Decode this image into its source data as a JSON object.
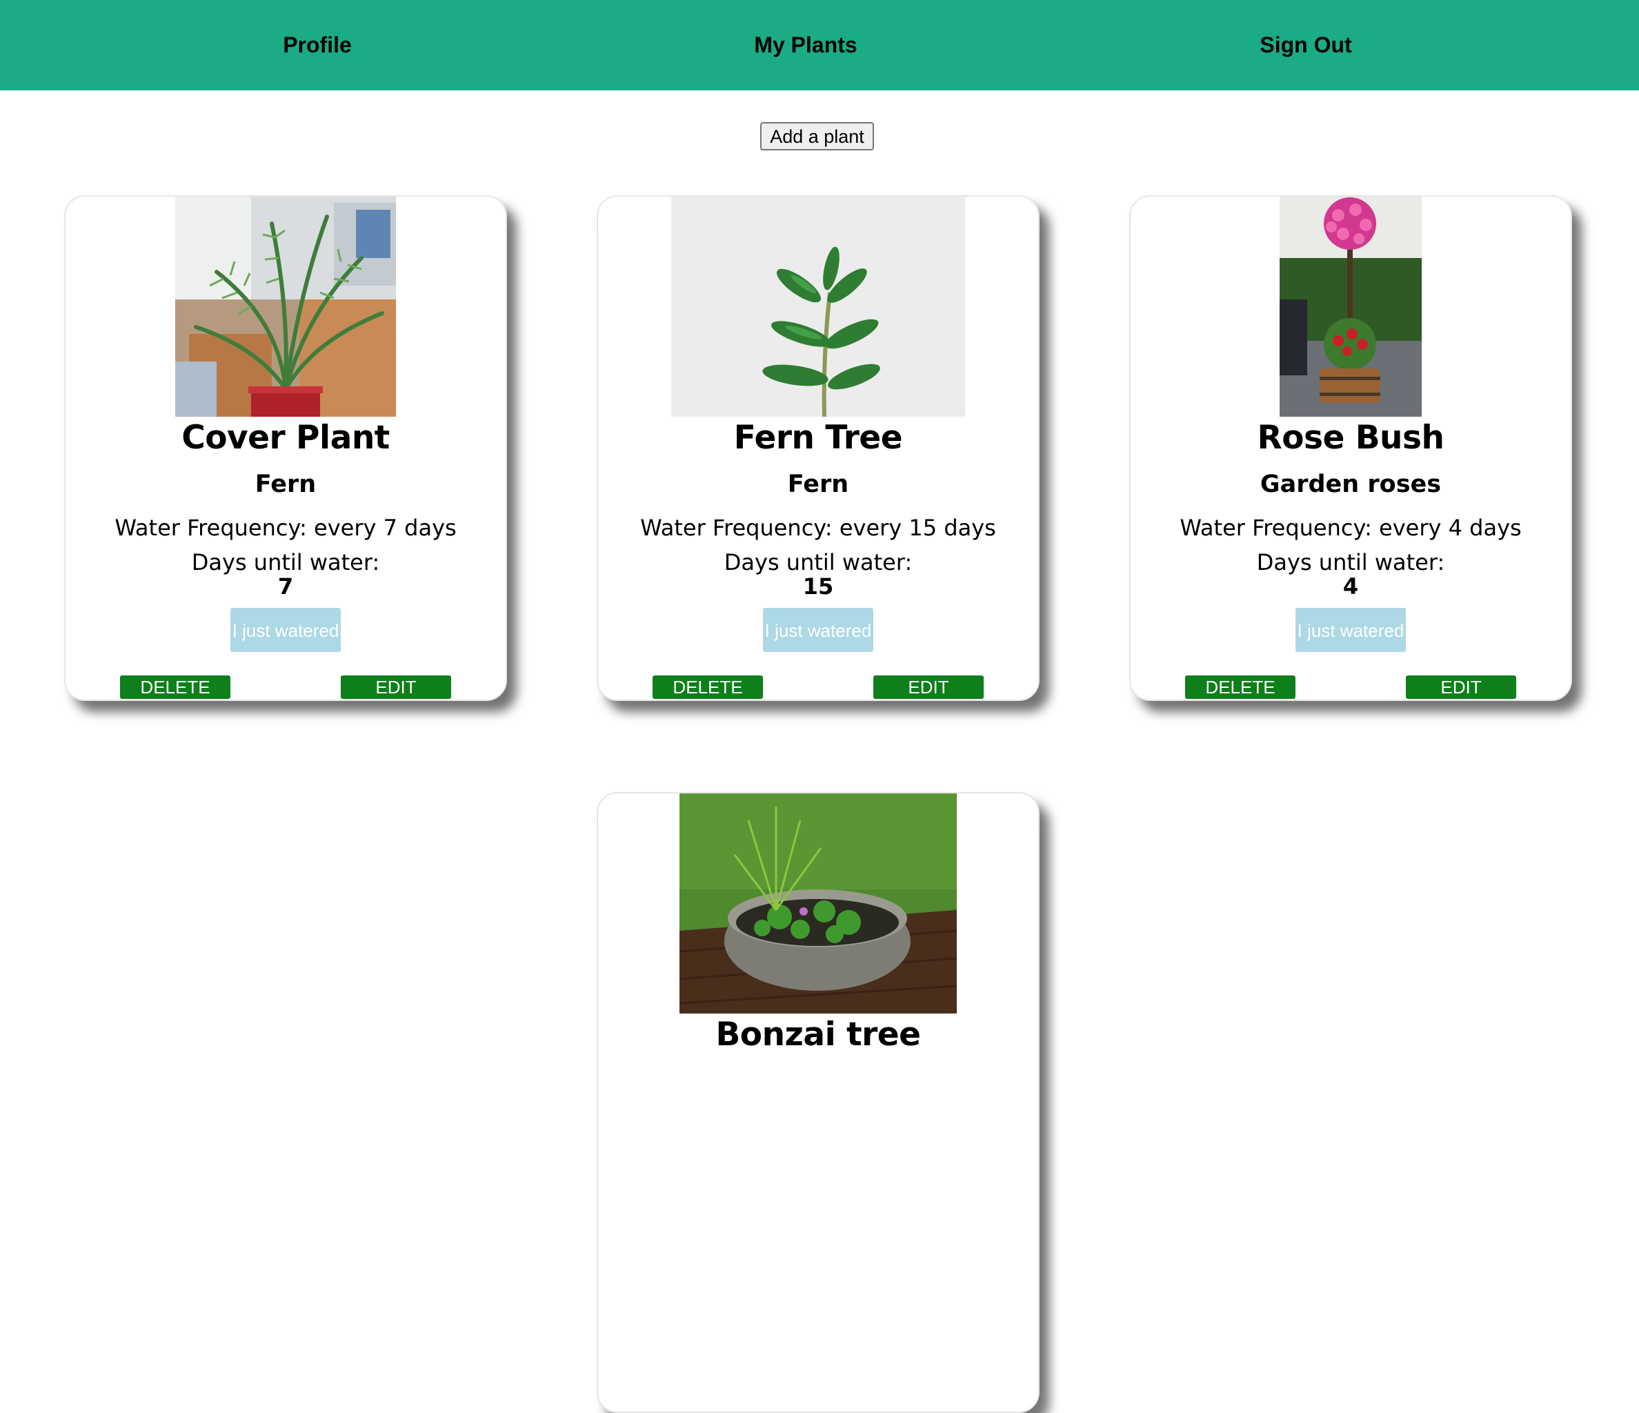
{
  "nav": {
    "profile": "Profile",
    "my_plants": "My Plants",
    "sign_out": "Sign Out"
  },
  "actions": {
    "add_plant": "Add a plant"
  },
  "colors": {
    "nav_bg": "#1bab86",
    "water_button": "#add8e6",
    "action_button": "#0f7f1b"
  },
  "plants": [
    {
      "name": "Cover Plant",
      "species": "Fern",
      "frequency": "Water Frequency: every 7 days",
      "until_label": "Days until water:",
      "days": "7",
      "water_label": "I just watered",
      "delete_label": "DELETE",
      "edit_label": "EDIT",
      "image": "indoor-palm-photo"
    },
    {
      "name": "Fern Tree",
      "species": "Fern",
      "frequency": "Water Frequency: every 15 days",
      "until_label": "Days until water:",
      "days": "15",
      "water_label": "I just watered",
      "delete_label": "DELETE",
      "edit_label": "EDIT",
      "image": "rubber-plant-photo"
    },
    {
      "name": "Rose Bush",
      "species": "Garden roses",
      "frequency": "Water Frequency: every 4 days",
      "until_label": "Days until water:",
      "days": "4",
      "water_label": "I just watered",
      "delete_label": "DELETE",
      "edit_label": "EDIT",
      "image": "rose-topiary-photo"
    },
    {
      "name": "Bonzai tree",
      "image": "water-garden-bowl-photo"
    }
  ]
}
